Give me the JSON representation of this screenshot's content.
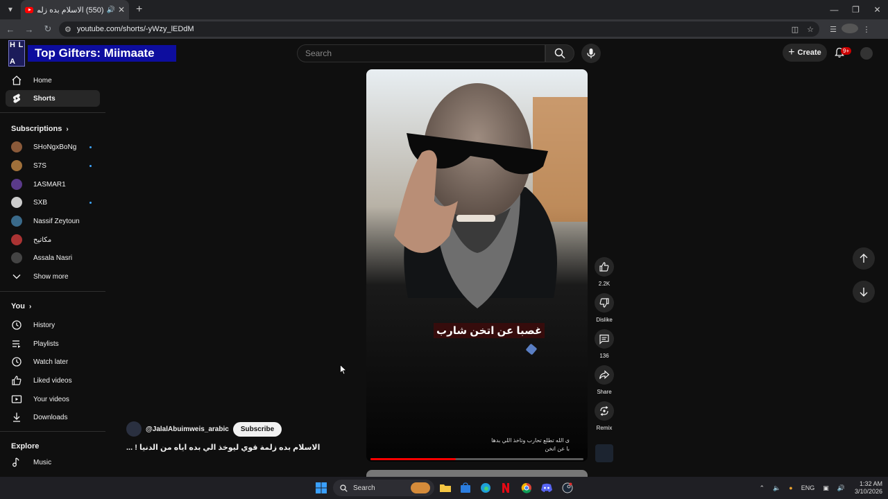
{
  "browser": {
    "tab_title": "(550) الاسلام بده زلمة قوي ل...",
    "url": "youtube.com/shorts/-yWzy_lEDdM"
  },
  "banner": {
    "logo_text": "H A L",
    "text": "Top Gifters: Miimaate"
  },
  "header": {
    "search_placeholder": "Search",
    "create_label": "Create",
    "notification_count": "9+"
  },
  "sidebar": {
    "main": [
      {
        "label": "Home",
        "icon": "home-icon"
      },
      {
        "label": "Shorts",
        "icon": "shorts-icon"
      }
    ],
    "subscriptions_title": "Subscriptions",
    "subscriptions": [
      {
        "label": "SHoNgxBoNg",
        "color": "#8a5a3a",
        "new": true
      },
      {
        "label": "S7S",
        "color": "#a0703a",
        "new": true
      },
      {
        "label": "1ASMAR1",
        "color": "#5a3a8a",
        "new": false
      },
      {
        "label": "SXB",
        "color": "#ccc",
        "new": true
      },
      {
        "label": "Nassif Zeytoun",
        "color": "#3a6a8a",
        "new": false
      },
      {
        "label": "مكاتيح",
        "color": "#aa3333",
        "new": false
      },
      {
        "label": "Assala Nasri",
        "color": "#444",
        "new": false
      }
    ],
    "show_more": "Show more",
    "you_title": "You",
    "you_items": [
      {
        "label": "History",
        "icon": "history-icon"
      },
      {
        "label": "Playlists",
        "icon": "playlists-icon"
      },
      {
        "label": "Watch later",
        "icon": "watch-later-icon"
      },
      {
        "label": "Liked videos",
        "icon": "liked-videos-icon"
      },
      {
        "label": "Your videos",
        "icon": "your-videos-icon"
      },
      {
        "label": "Downloads",
        "icon": "downloads-icon"
      }
    ],
    "explore_title": "Explore",
    "explore_items": [
      {
        "label": "Music",
        "icon": "music-icon"
      }
    ]
  },
  "short": {
    "caption": "غصبا عن اتخن شارب",
    "subtitle_line1": "ى الله تطلع تحارب وتاخذ اللي بدها",
    "subtitle_line2": "با عن اتخن",
    "progress": 0.4,
    "channel": "@JalalAbuimweis_arabic",
    "subscribe_label": "Subscribe",
    "title": "الاسلام بده زلمة قوي ليوخذ الي بده اياه من الدنيا ! ..."
  },
  "actions": {
    "like_count": "2.2K",
    "dislike_label": "Dislike",
    "comment_count": "136",
    "share_label": "Share",
    "remix_label": "Remix"
  },
  "taskbar": {
    "search_label": "Search",
    "language": "ENG",
    "time": "1:32 AM",
    "date": "3/10/2026"
  },
  "colors": {
    "accent_red": "#ff0000",
    "background": "#0f0f0f",
    "banner_blue": "#0d0d9e"
  }
}
